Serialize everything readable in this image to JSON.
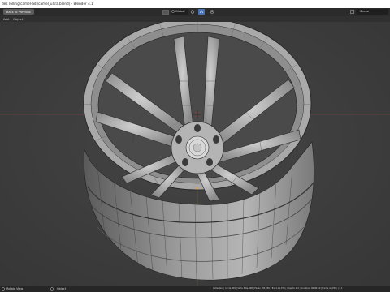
{
  "window": {
    "title": "des rolling\\camel-adi\\camel_ultra.blend] - Blender 4.1"
  },
  "topbar": {
    "back_label": "Back to Previous",
    "transform_orientation": "Global",
    "scene_label": "Scene"
  },
  "header": {
    "menu_items": [
      "Add",
      "Object"
    ]
  },
  "status": {
    "left_hint": "Rotate View",
    "mid_hint": "Object",
    "stats": "Collection | Circle.009 | Verts 3,8e,496 | Faces 705,336 | Tris 2,01,076 | Objects 1/4 | Duration: 00:00:10 (Frame 44/250) | 4.1"
  },
  "colors": {
    "accent": "#4772b3",
    "viewport_bg": "#3d3d3d",
    "axis_x": "#9a3f4a",
    "axis_y": "#6a8a2e",
    "origin": "#f0a030"
  },
  "icons": [
    "editor-type-icon",
    "object-mode-icon",
    "view-menu-icon",
    "global-orientation-icon",
    "pivot-icon",
    "snap-icon",
    "proportional-icon",
    "scene-icon",
    "cursor-icon",
    "mouse-icon"
  ]
}
